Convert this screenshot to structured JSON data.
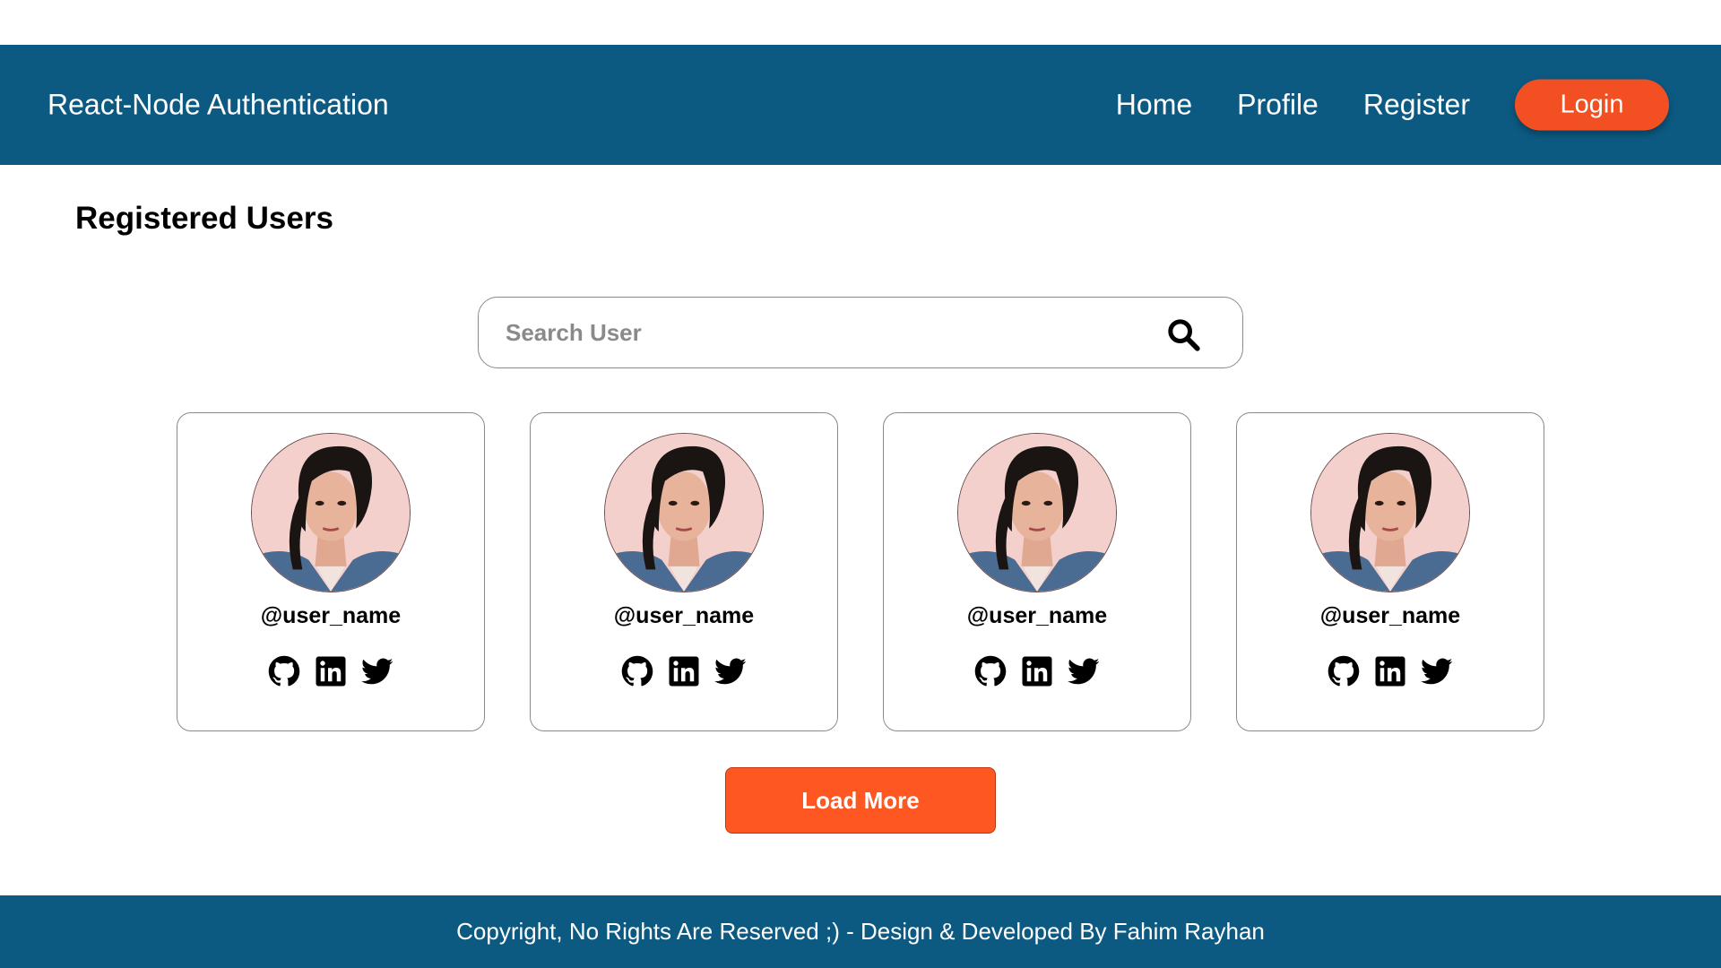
{
  "navbar": {
    "brand": "React-Node Authentication",
    "links": [
      "Home",
      "Profile",
      "Register"
    ],
    "login_label": "Login"
  },
  "main": {
    "title": "Registered Users",
    "search": {
      "placeholder": "Search User",
      "value": ""
    },
    "users": [
      {
        "username": "@user_name"
      },
      {
        "username": "@user_name"
      },
      {
        "username": "@user_name"
      },
      {
        "username": "@user_name"
      }
    ],
    "load_more_label": "Load More"
  },
  "footer": {
    "text": "Copyright, No Rights Are Reserved ;) - Design & Developed By Fahim Rayhan"
  },
  "colors": {
    "primary": "#0c5a82",
    "accent": "#f25022",
    "button": "#ff5722"
  },
  "icons": [
    "search-icon",
    "github-icon",
    "linkedin-icon",
    "twitter-icon"
  ]
}
